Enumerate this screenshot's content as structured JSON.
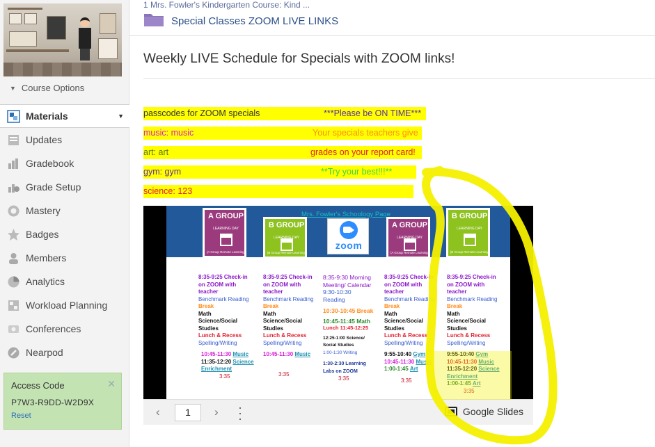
{
  "sidebar": {
    "course_options": "Course Options",
    "items": [
      {
        "label": "Materials",
        "icon": "materials-icon"
      },
      {
        "label": "Updates",
        "icon": "updates-icon"
      },
      {
        "label": "Gradebook",
        "icon": "gradebook-icon"
      },
      {
        "label": "Grade Setup",
        "icon": "grade-setup-icon"
      },
      {
        "label": "Mastery",
        "icon": "mastery-icon"
      },
      {
        "label": "Badges",
        "icon": "badges-icon"
      },
      {
        "label": "Members",
        "icon": "members-icon"
      },
      {
        "label": "Analytics",
        "icon": "analytics-icon"
      },
      {
        "label": "Workload Planning",
        "icon": "workload-planning-icon"
      },
      {
        "label": "Conferences",
        "icon": "conferences-icon"
      },
      {
        "label": "Nearpod",
        "icon": "nearpod-icon"
      }
    ],
    "access": {
      "title": "Access Code",
      "code": "P7W3-R9DD-W2D9X",
      "reset": "Reset"
    }
  },
  "breadcrumb": {
    "course": "1 Mrs. Fowler's Kindergarten Course: Kind ...",
    "folder": "Special Classes ZOOM LIVE LINKS"
  },
  "page": {
    "title": "Weekly LIVE Schedule for Specials with ZOOM links!"
  },
  "content": {
    "lines": [
      {
        "left": "passcodes for ZOOM specials",
        "right": "***Please be ON TIME***",
        "left_color": "#333333",
        "right_color": "#5a2ea6"
      },
      {
        "left": "music: music",
        "right": "Your specials teachers give",
        "left_color": "#d81bd8",
        "right_color": "#ff8c1a"
      },
      {
        "left": "art: art",
        "right": "grades on your report card!",
        "left_color": "#5a7a1a",
        "right_color": "#e0202f"
      },
      {
        "left": "gym: gym",
        "right": "**Try your best!!!**",
        "left_color": "#5a2ea6",
        "right_color": "#3dd63d"
      },
      {
        "left": "science: 123",
        "right": "",
        "left_color": "#e0202f",
        "right_color": "#333333"
      }
    ]
  },
  "slide": {
    "link_text": "Mrs. Fowler's Schoology Page",
    "cards": [
      {
        "title": "A GROUP",
        "sub": "LEARNING DAY",
        "note": "(A Group Remote Learning)",
        "color": "#9b3b7e"
      },
      {
        "title": "B GROUP",
        "sub": "LEARNING DAY",
        "note": "(B Group Remote Learning)",
        "color": "#8dc21f"
      },
      {
        "title": "A GROUP",
        "sub": "LEARNING DAY",
        "note": "(A Group Remote Learning)",
        "color": "#9b3b7e"
      },
      {
        "title": "B GROUP",
        "sub": "LEARNING DAY",
        "note": "(B Group Remote Learning)",
        "color": "#8dc21f"
      }
    ],
    "zoom_word": "zoom",
    "col1": {
      "a": "8:35-9:25 Check-in",
      "b": "on ZOOM with",
      "c": "teacher",
      "d": "Benchmark Reading",
      "e": "Break",
      "f": "Math",
      "g": "Science/Social",
      "h": "Studies",
      "i": "Lunch & Recess",
      "j": "Spelling/Writing",
      "k_t": "10:45-11:30",
      "k_l": "Music",
      "l_t": "11:35-12:20",
      "l_l": "Science",
      "m": "Enrichment",
      "n": "3:35"
    },
    "col2": {
      "a": "8:35-9:25 Check-in",
      "b": "on ZOOM with",
      "c": "teacher",
      "d": "Benchmark Reading",
      "e": "Break",
      "f": "Math",
      "g": "Science/Social",
      "h": "Studies",
      "i": "Lunch & Recess",
      "j": "Spelling/Writing",
      "k_t": "10:45-11:30",
      "k_l": "Music",
      "n": "3:35"
    },
    "col3": {
      "a": "8:35-9:30 Morning",
      "b": "Meeting/ Calendar",
      "c": "9:30-10:30",
      "d": "Reading",
      "e": "10:30-10:45 Break",
      "f": "10:45-11:45 Math",
      "g": "Lunch 11:45-12:25",
      "h": "12:25-1:00 Science/",
      "i": "Social Studies",
      "j": "1:00-1:30 Writing",
      "k": "1:30-2:30 Learning",
      "l": "Labs on ZOOM",
      "n": "3:35"
    },
    "col4": {
      "a": "8:35-9:25 Check-in",
      "b": "on ZOOM with",
      "c": "teacher",
      "d": "Benchmark Reading",
      "e": "Break",
      "f": "Math",
      "g": "Science/Social",
      "h": "Studies",
      "i": "Lunch & Recess",
      "j": "Spelling/Writing",
      "k_t": "9:55-10:40",
      "k_l": "Gym",
      "l_t": "10:45-11:30",
      "l_l": "Music",
      "m_t": "1:00-1:45",
      "m_l": "Art",
      "n": "3:35"
    },
    "col5": {
      "a": "8:35-9:25 Check-in",
      "b": "on ZOOM with",
      "c": "teacher",
      "d": "Benchmark Reading",
      "e": "Break",
      "f": "Math",
      "g": "Science/Social",
      "h": "Studies",
      "i": "Lunch & Recess",
      "j": "Spelling/Writing",
      "k_t": "9:55-10:40",
      "k_l": "Gym",
      "l_t": "10:45-11:30",
      "l_l": "Music",
      "m_t": "11:35-12:20",
      "m_l": "Science",
      "o": "Enrichment",
      "p_t": "1:00-1:45",
      "p_l": "Art",
      "n": "3:35"
    }
  },
  "viewer": {
    "page": "1",
    "brand": "Google Slides"
  },
  "colors": {
    "highlight": "#ffff00",
    "access_bg": "#c4e3b3",
    "link_blue": "#2c6fb5",
    "banner": "#21599a"
  }
}
